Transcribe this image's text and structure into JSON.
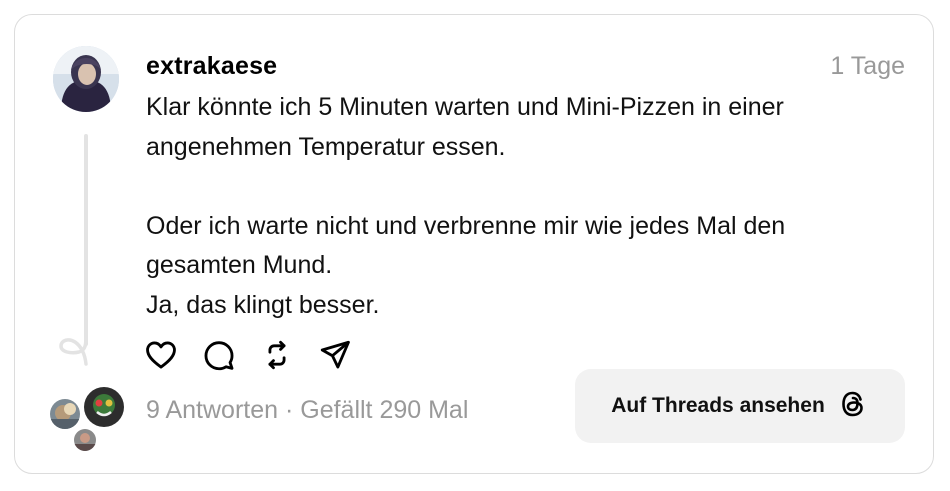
{
  "post": {
    "username": "extrakaese",
    "time_ago": "1 Tage",
    "text": "Klar könnte ich 5 Minuten warten und Mini-Pizzen in einer\nangenehmen Temperatur essen.\n\nOder ich warte nicht und verbrenne mir wie jedes Mal den\ngesamten Mund.\nJa, das klingt besser.",
    "stats": "9 Antworten · Gefällt 290 Mal"
  },
  "actions": {
    "icons": [
      "heart-icon",
      "comment-icon",
      "repost-icon",
      "share-icon"
    ]
  },
  "cta": {
    "label": "Auf Threads ansehen",
    "icon": "threads-logo-icon"
  },
  "colors": {
    "muted": "#999999",
    "border": "#dcdcdc",
    "button_bg": "#f2f2f2"
  }
}
